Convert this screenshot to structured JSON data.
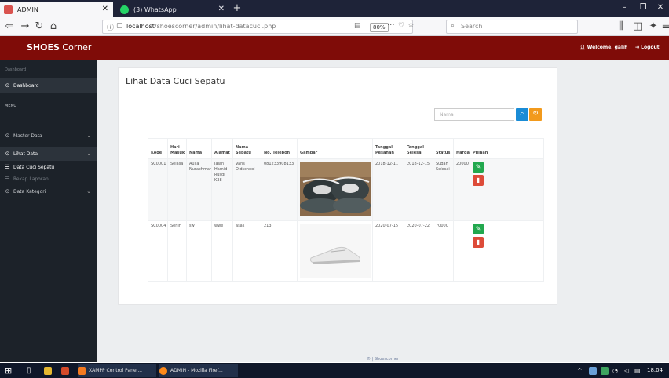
{
  "browser": {
    "tabs": [
      {
        "title": "ADMIN",
        "icon_color": "#d9534f"
      },
      {
        "title": "(3) WhatsApp",
        "icon_color": "#25d366"
      }
    ],
    "new_tab": "+",
    "url_host": "localhost",
    "url_path": "/shoescorner/admin/lihat-datacuci.php",
    "zoom": "80%",
    "search_placeholder": "Search",
    "window": {
      "minimize": "–",
      "maximize": "❐",
      "close": "✕"
    }
  },
  "app": {
    "brand_bold": "SHOES",
    "brand_rest": " Corner",
    "welcome": "Welcome, galih",
    "logout": "Logout"
  },
  "sidebar": {
    "section_label": "Dashboard",
    "dashboard": "Dashboard",
    "menu_label": "MENU",
    "master_data": "Master Data",
    "lihat_data": "Lihat Data",
    "data_cuci_sepatu": "Data Cuci Sepatu",
    "rekap_laporan": "Rekap Laporan",
    "data_kategori": "Data Kategori"
  },
  "main": {
    "title": "Lihat Data Cuci Sepatu",
    "search_placeholder": "Nama",
    "columns": [
      "Kode",
      "Hari Masuk",
      "Nama",
      "Alamat",
      "Nama Sepatu",
      "No. Telepon",
      "Gambar",
      "Tanggal Pesanan",
      "Tanggal Selesai",
      "Status",
      "Harga",
      "Pilihan"
    ],
    "rows": [
      {
        "kode": "SC0001",
        "hari": "Selasa",
        "nama": "Aulia Nurachman",
        "alamat": "Jalan Hamid Rusdi K38",
        "sepatu": "Vans Oldschool",
        "telepon": "081233908133",
        "tgl_pesan": "2018-12-11",
        "tgl_selesai": "2018-12-15",
        "status": "Sudah Selesai",
        "harga": "20000"
      },
      {
        "kode": "SC0004",
        "hari": "Senin",
        "nama": "sw",
        "alamat": "wwe",
        "sepatu": "asas",
        "telepon": "213",
        "tgl_pesan": "2020-07-15",
        "tgl_selesai": "2020-07-22",
        "status": "70000",
        "harga": ""
      }
    ]
  },
  "footer": "© | Shoescorner",
  "taskbar": {
    "xampp": "XAMPP Control Panel...",
    "firefox": "ADMIN - Mozilla Firef...",
    "clock": "18.04"
  },
  "colors": {
    "header": "#7f0c08",
    "sidebar": "#1c2229",
    "accent_blue": "#1a8cd6",
    "accent_orange": "#f29a1c",
    "edit_green": "#22a84e",
    "delete_red": "#dd4b39"
  },
  "icons": [
    "windows-icon",
    "search-icon",
    "refresh-icon",
    "pencil-icon",
    "trash-icon",
    "user-icon",
    "logout-icon",
    "dashboard-icon",
    "list-icon"
  ]
}
